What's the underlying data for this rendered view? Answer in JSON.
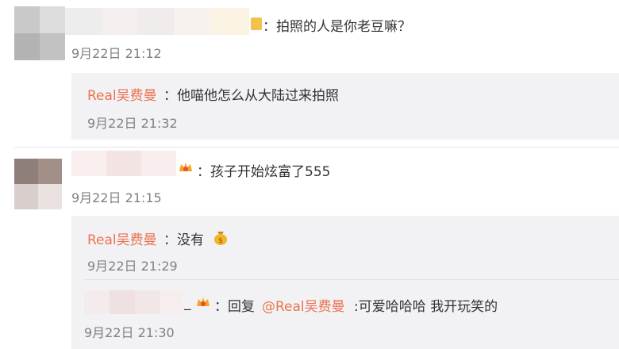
{
  "comments": [
    {
      "text": "：拍照的人是你老豆嘛？",
      "time": "9月22日 21:12",
      "reply": {
        "user": "Real吴费曼",
        "text": "：他喵他怎么从大陆过来拍照",
        "time": "9月22日 21:32"
      }
    },
    {
      "text": "：孩子开始炫富了555",
      "time": "9月22日 21:15",
      "replies": [
        {
          "user": "Real吴费曼",
          "text": "：没有",
          "time": "9月22日 21:29",
          "icon": "money-bag-icon"
        },
        {
          "text_prefix": "：回复",
          "mention": "@Real吴费曼",
          "text": ":可爱哈哈哈 我开玩笑的",
          "time": "9月22日 21:30"
        }
      ]
    }
  ],
  "colors": {
    "name": "#eb7350",
    "time": "#808080",
    "reply_bg": "#f2f2f5",
    "divider": "#e6e6e6"
  }
}
